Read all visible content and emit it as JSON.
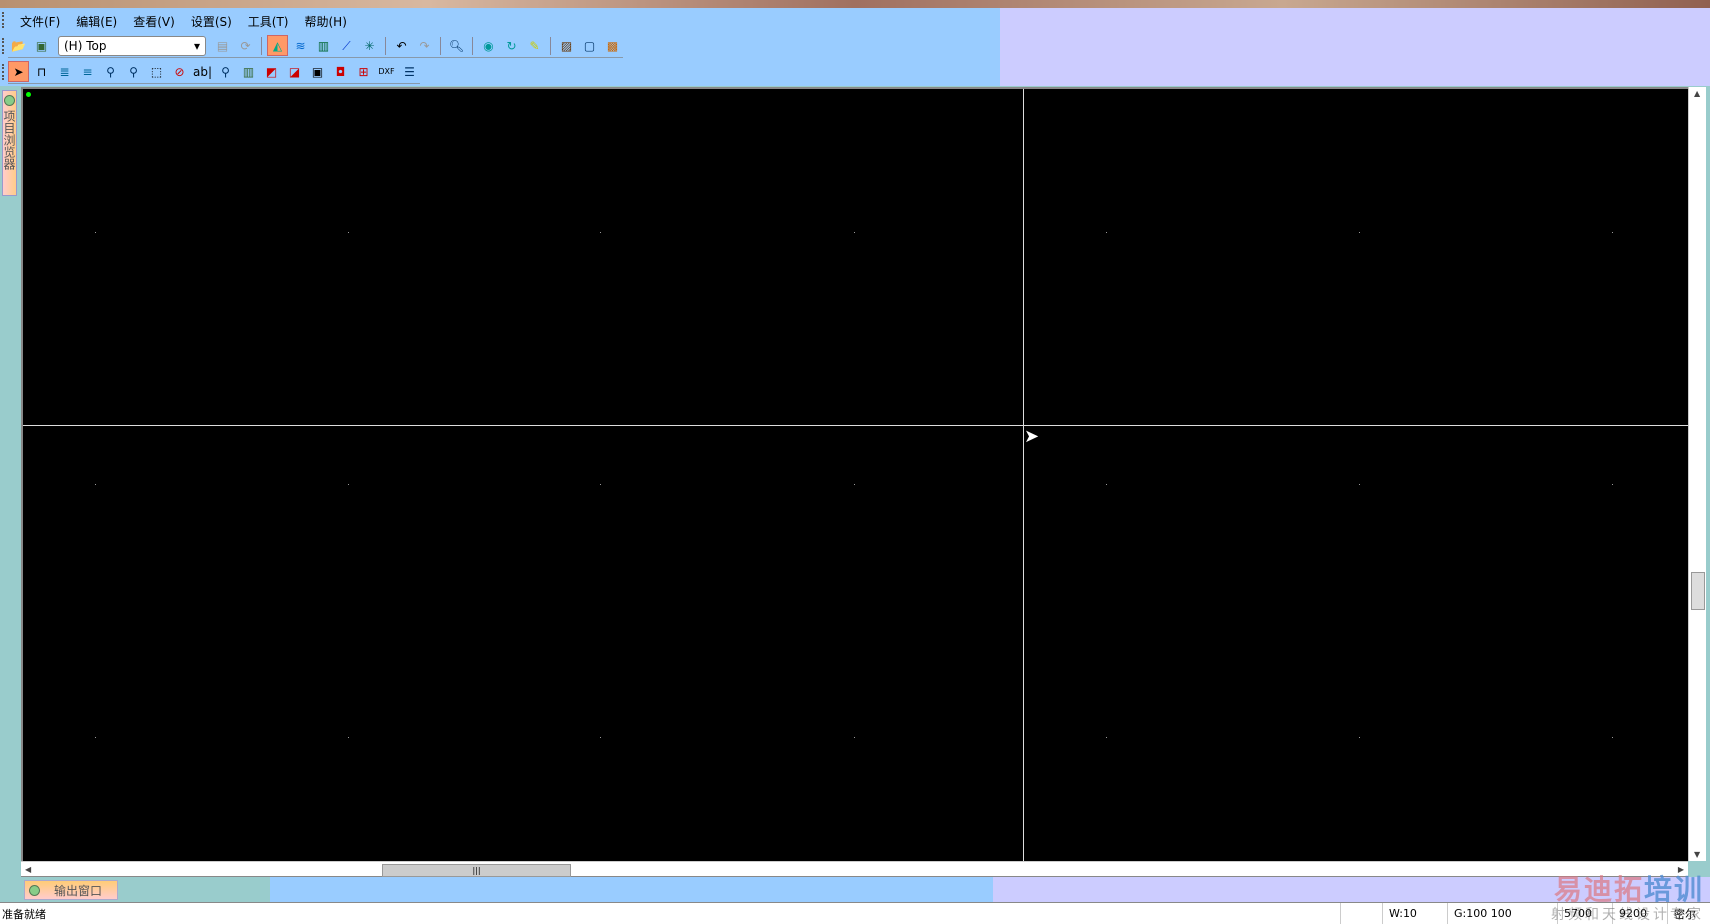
{
  "menu": [
    "文件(F)",
    "编辑(E)",
    "查看(V)",
    "设置(S)",
    "工具(T)",
    "帮助(H)"
  ],
  "toolbar1": {
    "layer_select": "(H) Top"
  },
  "sidebar": {
    "tab": "项目浏览器"
  },
  "output": {
    "tab": "输出窗口"
  },
  "status": {
    "ready": "准备就绪",
    "width": "W:10",
    "grid": "G:100 100",
    "x": "5700",
    "y": "9200",
    "units": "密尔"
  },
  "watermark": {
    "brand_a": "易迪拓",
    "brand_b": "培训",
    "tagline": "射频和天线设计专家"
  }
}
